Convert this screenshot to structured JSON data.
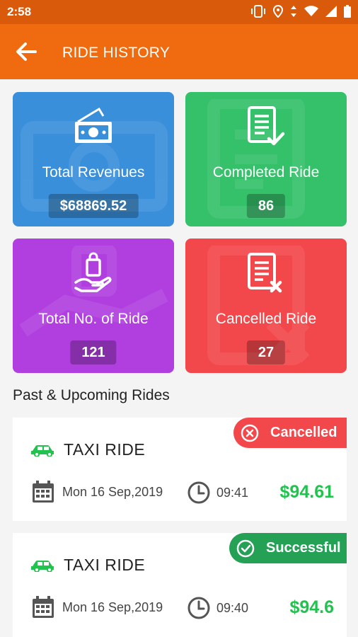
{
  "status_bar": {
    "time": "2:58"
  },
  "app_bar": {
    "title": "RIDE HISTORY"
  },
  "stats": [
    {
      "label": "Total Revenues",
      "value": "$68869.52",
      "color": "#3a8fdb"
    },
    {
      "label": "Completed Ride",
      "value": "86",
      "color": "#35c06a"
    },
    {
      "label": "Total No. of Ride",
      "value": "121",
      "color": "#b13fe0"
    },
    {
      "label": "Cancelled Ride",
      "value": "27",
      "color": "#f2474b"
    }
  ],
  "section_title": "Past & Upcoming Rides",
  "rides": [
    {
      "type": "TAXI RIDE",
      "status": "Cancelled",
      "status_color": "#f2474b",
      "date": "Mon 16 Sep,2019",
      "time": "09:41",
      "price": "$94.61"
    },
    {
      "type": "TAXI RIDE",
      "status": "Successful",
      "status_color": "#24a155",
      "date": "Mon 16 Sep,2019",
      "time": "09:40",
      "price": "$94.6"
    }
  ],
  "colors": {
    "accent": "#f06a0f",
    "status_bar": "#d95a0b",
    "price": "#22c24f"
  },
  "icons": {
    "back": "arrow-left-icon",
    "car": "car-icon",
    "calendar": "calendar-icon",
    "clock": "clock-icon"
  }
}
